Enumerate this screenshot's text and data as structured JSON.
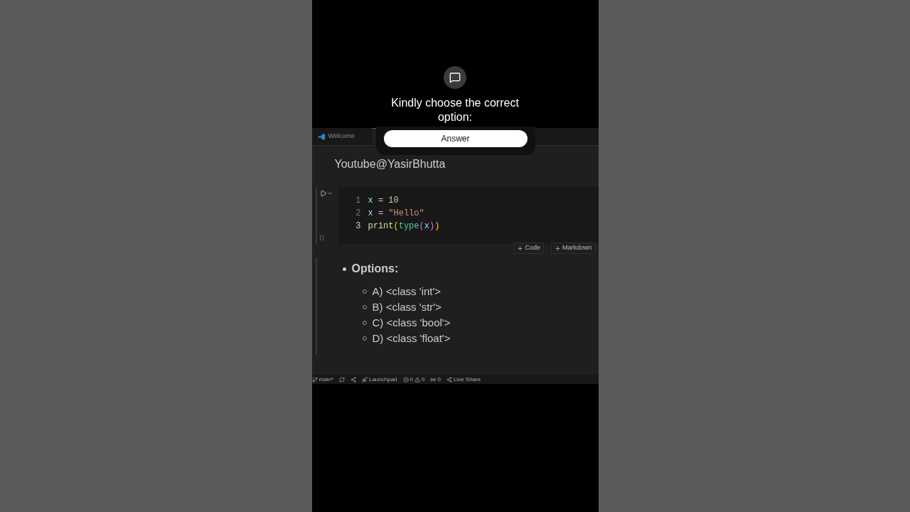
{
  "prompt": {
    "title": "Kindly choose the correct option:",
    "button": "Answer"
  },
  "tabs": [
    {
      "label": "Welcome",
      "selected": false
    },
    {
      "selected": true
    }
  ],
  "notebook": {
    "heading": "Youtube@YasirBhutta",
    "cell": {
      "execution_count": "[ ]",
      "lines": [
        {
          "number": "1",
          "current": false,
          "tokens": [
            {
              "text": "x",
              "kind": "var"
            },
            {
              "text": " = ",
              "kind": "op"
            },
            {
              "text": "10",
              "kind": "num"
            }
          ]
        },
        {
          "number": "2",
          "current": false,
          "tokens": [
            {
              "text": "x",
              "kind": "var"
            },
            {
              "text": " = ",
              "kind": "op"
            },
            {
              "text": "\"Hello\"",
              "kind": "str"
            }
          ]
        },
        {
          "number": "3",
          "current": true,
          "tokens": [
            {
              "text": "print",
              "kind": "func"
            },
            {
              "text": "(",
              "kind": "paren1"
            },
            {
              "text": "type",
              "kind": "builtin"
            },
            {
              "text": "(",
              "kind": "paren2"
            },
            {
              "text": "x",
              "kind": "var"
            },
            {
              "text": ")",
              "kind": "paren2"
            },
            {
              "text": ")",
              "kind": "paren1"
            }
          ]
        }
      ]
    },
    "add_buttons": [
      "Code",
      "Markdown"
    ],
    "markdown": {
      "heading": "Options:",
      "options": [
        "A) <class 'int'>",
        "B) <class 'str'>",
        "C) <class 'bool'>",
        "D) <class 'float'>"
      ]
    }
  },
  "status_bar": {
    "branch": "main*",
    "launchpad": "Launchpad",
    "errors": "0",
    "warnings": "0",
    "ports": "0",
    "live_share": "Live Share"
  }
}
